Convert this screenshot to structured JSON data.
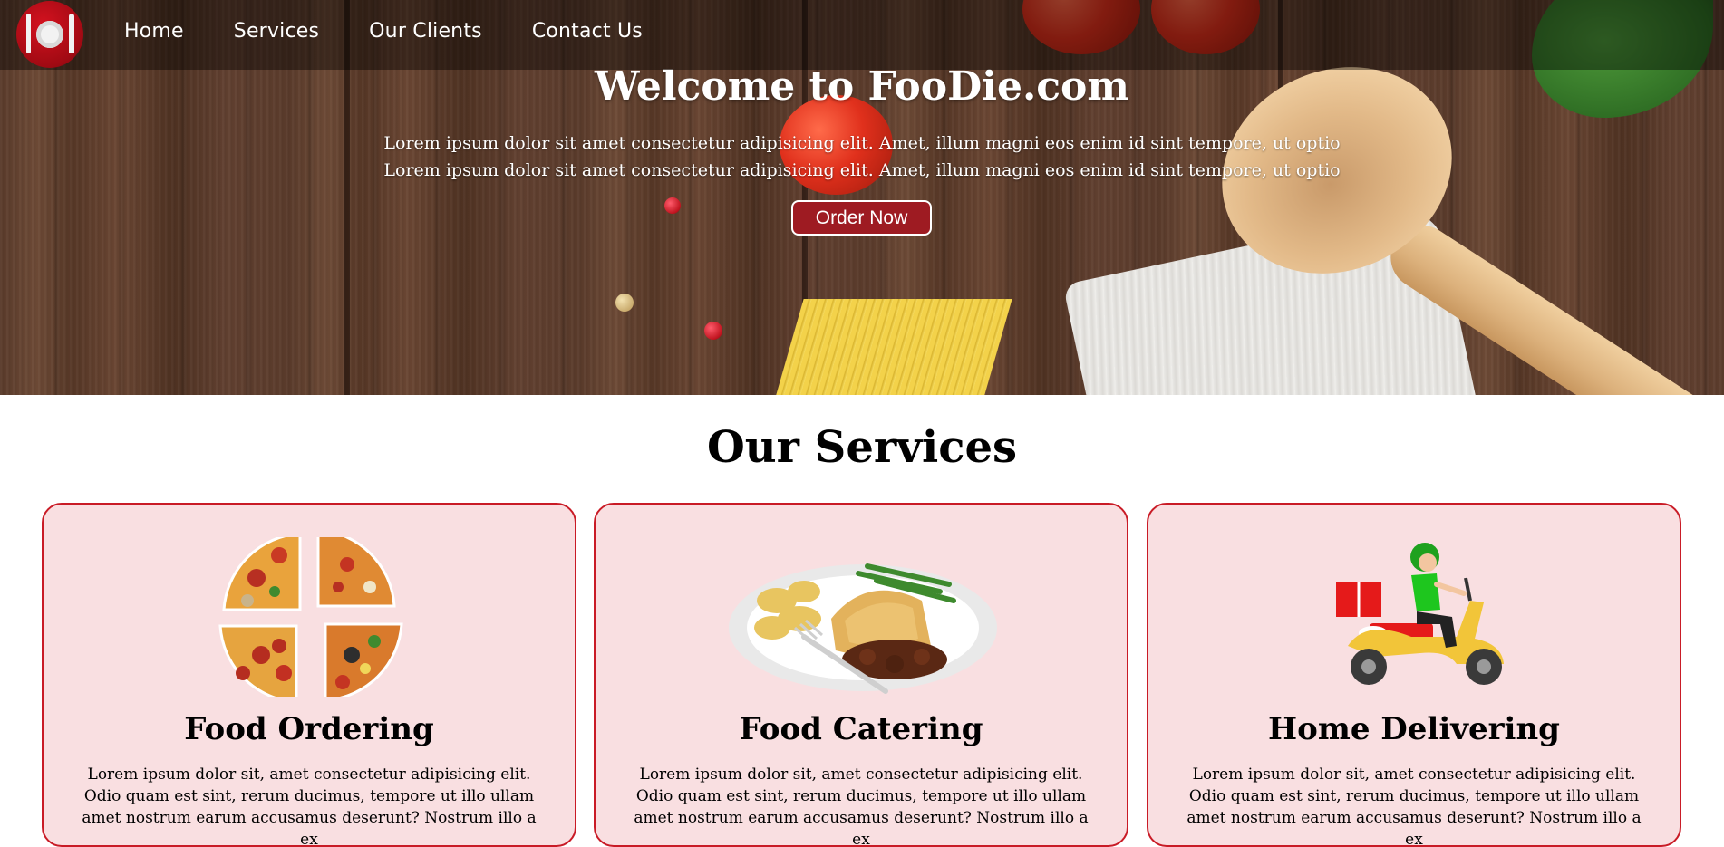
{
  "site": {
    "brand": "FooDie.com"
  },
  "nav": {
    "items": [
      {
        "label": "Home"
      },
      {
        "label": "Services"
      },
      {
        "label": "Our Clients"
      },
      {
        "label": "Contact Us"
      }
    ]
  },
  "hero": {
    "title": "Welcome to FooDie.com",
    "lines": [
      "Lorem ipsum dolor sit amet consectetur adipisicing elit. Amet, illum magni eos enim id sint tempore, ut optio",
      "Lorem ipsum dolor sit amet consectetur adipisicing elit. Amet, illum magni eos enim id sint tempore, ut optio"
    ],
    "button": "Order Now"
  },
  "services": {
    "title": "Our Services",
    "cards": [
      {
        "title": "Food Ordering",
        "icon": "pizza-icon",
        "text": "Lorem ipsum dolor sit, amet consectetur adipisicing elit. Odio quam est sint, rerum ducimus, tempore ut illo ullam amet nostrum earum accusamus deserunt? Nostrum illo a ex"
      },
      {
        "title": "Food Catering",
        "icon": "plated-meal-icon",
        "text": "Lorem ipsum dolor sit, amet consectetur adipisicing elit. Odio quam est sint, rerum ducimus, tempore ut illo ullam amet nostrum earum accusamus deserunt? Nostrum illo a ex"
      },
      {
        "title": "Home Delivering",
        "icon": "delivery-scooter-icon",
        "text": "Lorem ipsum dolor sit, amet consectetur adipisicing elit. Odio quam est sint, rerum ducimus, tempore ut illo ullam amet nostrum earum accusamus deserunt? Nostrum illo a ex"
      }
    ]
  },
  "colors": {
    "brand_red": "#c91b26",
    "card_bg": "#f9dfe1",
    "button_bg": "#9e1b22"
  }
}
